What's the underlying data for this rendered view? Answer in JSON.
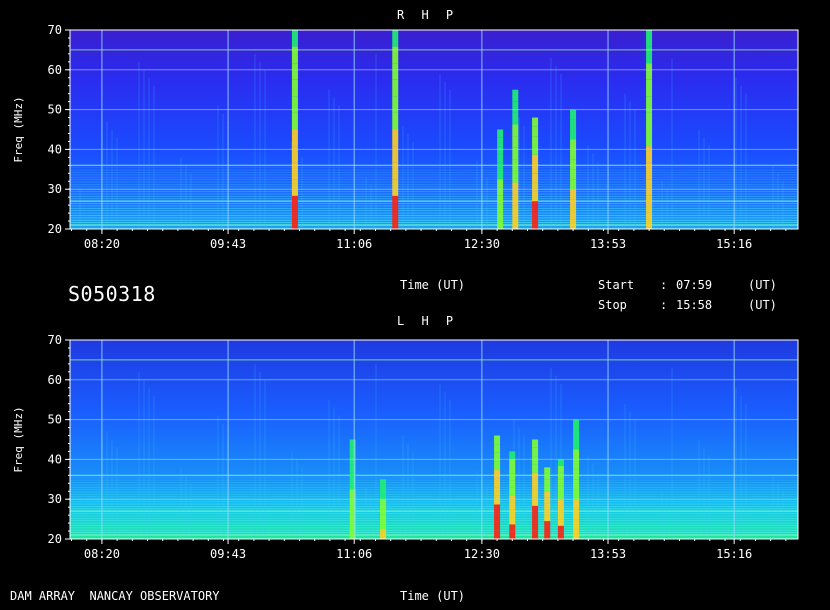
{
  "page": {
    "observation_id": "S050318",
    "footer_label": "DAM ARRAY  NANCAY OBSERVATORY",
    "time_axis_label": "Time (UT)",
    "start_label": "Start",
    "start_time": "07:59",
    "stop_label": "Stop",
    "stop_time": "15:58",
    "colon": ":",
    "ut_tag": "(UT)"
  },
  "colors": {
    "background": "#000000",
    "axis": "#ffffff",
    "grid": "#9ad8ff"
  },
  "chart_data": [
    {
      "type": "heatmap",
      "title": "R H P",
      "xlabel": "Time (UT)",
      "ylabel": "Freq (MHz)",
      "xlim": [
        "07:59",
        "15:58"
      ],
      "ylim": [
        20,
        70
      ],
      "x_ticks": [
        "08:20",
        "09:43",
        "11:06",
        "12:30",
        "13:53",
        "15:16"
      ],
      "y_ticks": [
        20,
        30,
        40,
        50,
        60,
        70
      ],
      "grid": true,
      "colormap": "blue-cyan-green-yellow-red",
      "bursts": [
        {
          "time": "10:27",
          "fmin": 20,
          "fmax": 70,
          "level": 0.9
        },
        {
          "time": "11:33",
          "fmin": 20,
          "fmax": 70,
          "level": 0.9
        },
        {
          "time": "12:42",
          "fmin": 20,
          "fmax": 45,
          "level": 0.7
        },
        {
          "time": "12:52",
          "fmin": 20,
          "fmax": 55,
          "level": 0.8
        },
        {
          "time": "13:05",
          "fmin": 20,
          "fmax": 48,
          "level": 0.95
        },
        {
          "time": "13:30",
          "fmin": 20,
          "fmax": 50,
          "level": 0.8
        },
        {
          "time": "14:20",
          "fmin": 20,
          "fmax": 70,
          "level": 0.85
        }
      ]
    },
    {
      "type": "heatmap",
      "title": "L H P",
      "xlabel": "Time (UT)",
      "ylabel": "Freq (MHz)",
      "xlim": [
        "07:59",
        "15:58"
      ],
      "ylim": [
        20,
        70
      ],
      "x_ticks": [
        "08:20",
        "09:43",
        "11:06",
        "12:30",
        "13:53",
        "15:16"
      ],
      "y_ticks": [
        20,
        30,
        40,
        50,
        60,
        70
      ],
      "grid": true,
      "colormap": "blue-cyan-green-yellow-red",
      "bursts": [
        {
          "time": "11:05",
          "fmin": 20,
          "fmax": 45,
          "level": 0.7
        },
        {
          "time": "11:25",
          "fmin": 20,
          "fmax": 35,
          "level": 0.75
        },
        {
          "time": "12:40",
          "fmin": 20,
          "fmax": 46,
          "level": 1.0
        },
        {
          "time": "12:50",
          "fmin": 20,
          "fmax": 42,
          "level": 0.9
        },
        {
          "time": "13:05",
          "fmin": 20,
          "fmax": 45,
          "level": 1.0
        },
        {
          "time": "13:13",
          "fmin": 20,
          "fmax": 38,
          "level": 0.95
        },
        {
          "time": "13:22",
          "fmin": 20,
          "fmax": 40,
          "level": 0.9
        },
        {
          "time": "13:32",
          "fmin": 20,
          "fmax": 50,
          "level": 0.8
        }
      ]
    }
  ]
}
